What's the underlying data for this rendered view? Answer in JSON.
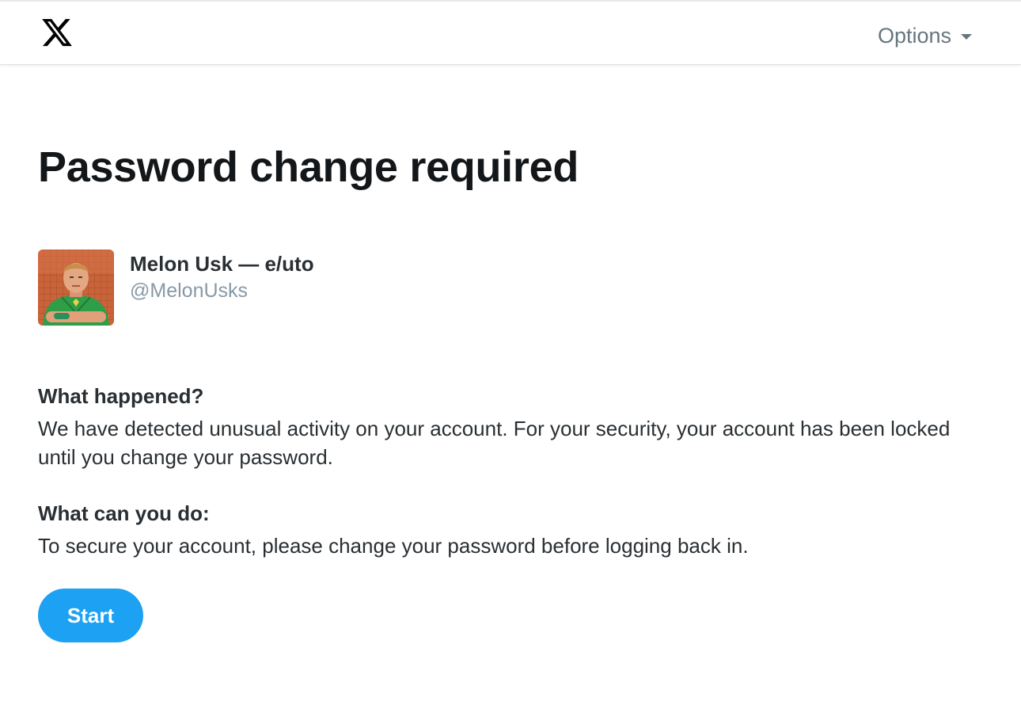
{
  "header": {
    "logo_icon": "x-logo-icon",
    "options_label": "Options",
    "options_icon": "caret-down-icon"
  },
  "page": {
    "title": "Password change required"
  },
  "account": {
    "display_name": "Melon Usk — e/uto",
    "handle": "@MelonUsks",
    "avatar_icon": "avatar-image"
  },
  "sections": [
    {
      "heading": "What happened?",
      "body": "We have detected unusual activity on your account. For your security, your account has been locked until you change your password."
    },
    {
      "heading": "What can you do:",
      "body": "To secure your account, please change your password before logging back in."
    }
  ],
  "actions": {
    "start_label": "Start"
  },
  "colors": {
    "accent": "#1da1f2",
    "text_primary": "#14171a",
    "text_secondary": "#8899a6",
    "options_text": "#66757f"
  }
}
